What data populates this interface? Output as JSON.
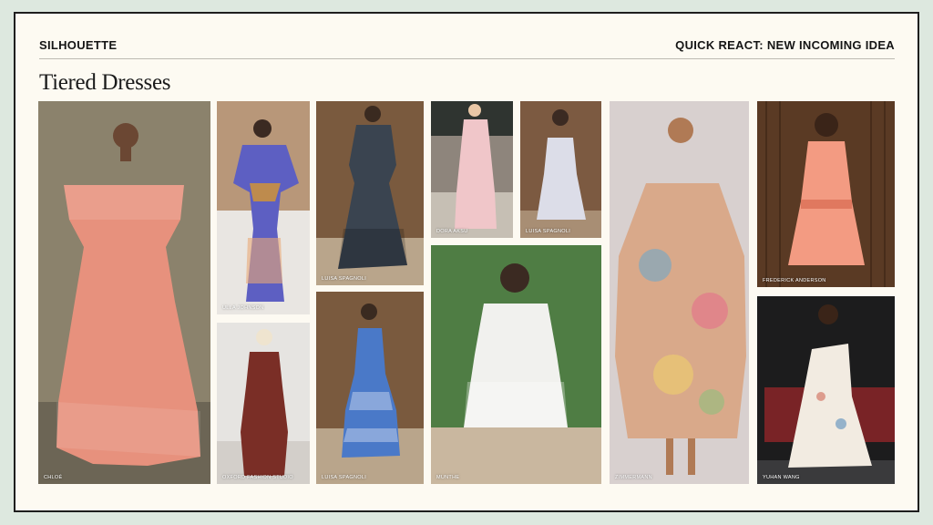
{
  "header": {
    "section": "SILHOUETTE",
    "tag": "QUICK REACT: NEW INCOMING IDEA"
  },
  "title": "Tiered Dresses",
  "photos": [
    {
      "caption": "CHLOÉ",
      "dress_color": "#e7917d",
      "bg_color": "#8b826c"
    },
    {
      "caption": "ULLA JOHNSON",
      "dress_color": "#5d5fc2",
      "bg_color": "#b89779"
    },
    {
      "caption": "OXFORD FASHION STUDIO",
      "dress_color": "#7a2e26",
      "bg_color": "#e6e4e1"
    },
    {
      "caption": "LUISA SPAGNOLI",
      "dress_color": "#3a4450",
      "bg_color": "#7a5a3e"
    },
    {
      "caption": "LUISA SPAGNOLI",
      "dress_color": "#4a79c8",
      "bg_color": "#7a5a3e"
    },
    {
      "caption": "DORA AKSU",
      "dress_color": "#f0c6c9",
      "bg_color": "#8e857c"
    },
    {
      "caption": "LUISA SPAGNOLI",
      "dress_color": "#dcdde8",
      "bg_color": "#7c5a41"
    },
    {
      "caption": "MUNTHE",
      "dress_color": "#f1f1ee",
      "bg_color": "#4f7d44"
    },
    {
      "caption": "ZIMMERMANN",
      "dress_color": "#d9a98a",
      "bg_color": "#d8d0cf"
    },
    {
      "caption": "FREDERICK ANDERSON",
      "dress_color": "#f39b82",
      "bg_color": "#5a3a24"
    },
    {
      "caption": "YUHAN WANG",
      "dress_color": "#f2ebe1",
      "bg_color": "#1c1c1d"
    }
  ]
}
